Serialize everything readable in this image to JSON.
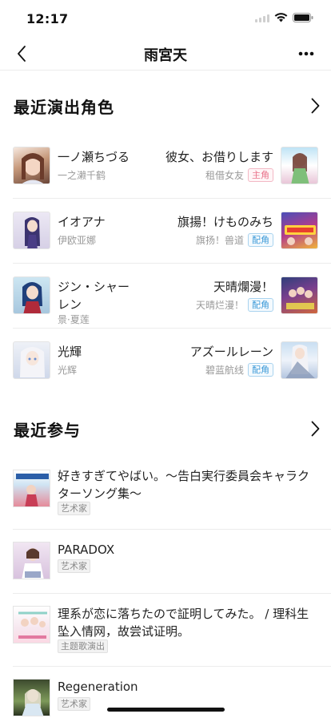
{
  "status_bar": {
    "time": "12:17"
  },
  "nav": {
    "title": "雨宮天"
  },
  "roles_section": {
    "title": "最近演出角色",
    "items": [
      {
        "character": "一ノ瀬ちづる",
        "character_cn": "一之濑千鹤",
        "anime": "彼女、お借りします",
        "anime_cn": "租借女友",
        "role": "主角",
        "role_type": "lead"
      },
      {
        "character": "イオアナ",
        "character_cn": "伊欧亚娜",
        "anime": "旗揚！けものみち",
        "anime_cn": "旗扬！兽道",
        "role": "配角",
        "role_type": "support"
      },
      {
        "character": "ジン・シャーレン",
        "character_cn": "景·夏莲",
        "anime": "天晴爛漫！",
        "anime_cn": "天晴烂漫！",
        "role": "配角",
        "role_type": "support"
      },
      {
        "character": "光輝",
        "character_cn": "光辉",
        "anime": "アズールレーン",
        "anime_cn": "碧蓝航线",
        "role": "配角",
        "role_type": "support"
      }
    ]
  },
  "works_section": {
    "title": "最近参与",
    "items": [
      {
        "title": "好きすぎてやばい。～告白実行委員会キャラクターソング集～",
        "tag": "艺术家"
      },
      {
        "title": "PARADOX",
        "tag": "艺术家"
      },
      {
        "title": "理系が恋に落ちたので証明してみた。 / 理科生坠入情网，故尝试证明。",
        "tag": "主题歌演出"
      },
      {
        "title": "Regeneration",
        "tag": "艺术家"
      }
    ]
  },
  "colors": {
    "lead_badge": "#e9748c",
    "support_badge": "#3d9ad8",
    "divider": "#ececec"
  }
}
